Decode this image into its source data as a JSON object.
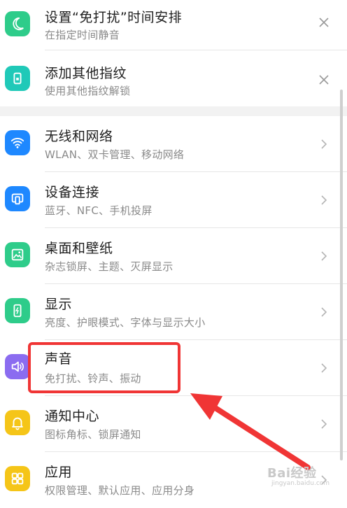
{
  "colors": {
    "green": "#2ecc8a",
    "teal": "#20c9b8",
    "blue": "#1e88ff",
    "purple": "#8b6cf0",
    "yellow": "#f5c518",
    "highlight_red": "#f03535"
  },
  "rows": [
    {
      "icon": "moon-icon",
      "title": "设置“免打扰”时间安排",
      "subtitle": "在指定时间静音",
      "trailing": "close-icon"
    },
    {
      "icon": "fingerprint-lock-icon",
      "title": "添加其他指纹",
      "subtitle": "使用其他指纹解锁",
      "trailing": "close-icon"
    },
    {
      "icon": "wifi-icon",
      "title": "无线和网络",
      "subtitle": "WLAN、双卡管理、移动网络",
      "trailing": "chevron-right-icon"
    },
    {
      "icon": "device-connection-icon",
      "title": "设备连接",
      "subtitle": "蓝牙、NFC、手机投屏",
      "trailing": "chevron-right-icon"
    },
    {
      "icon": "wallpaper-icon",
      "title": "桌面和壁纸",
      "subtitle": "杂志锁屏、主题、灭屏显示",
      "trailing": "chevron-right-icon"
    },
    {
      "icon": "display-icon",
      "title": "显示",
      "subtitle": "亮度、护眼模式、字体与显示大小",
      "trailing": "chevron-right-icon"
    },
    {
      "icon": "speaker-icon",
      "title": "声音",
      "subtitle": "免打扰、铃声、振动",
      "trailing": "chevron-right-icon"
    },
    {
      "icon": "bell-icon",
      "title": "通知中心",
      "subtitle": "图标角标、锁屏通知",
      "trailing": "chevron-right-icon"
    },
    {
      "icon": "apps-grid-icon",
      "title": "应用",
      "subtitle": "权限管理、默认应用、应用分身",
      "trailing": "chevron-right-icon"
    }
  ],
  "watermark": {
    "text": "Bai经验",
    "url_text": "jingyan.baidu.com"
  }
}
